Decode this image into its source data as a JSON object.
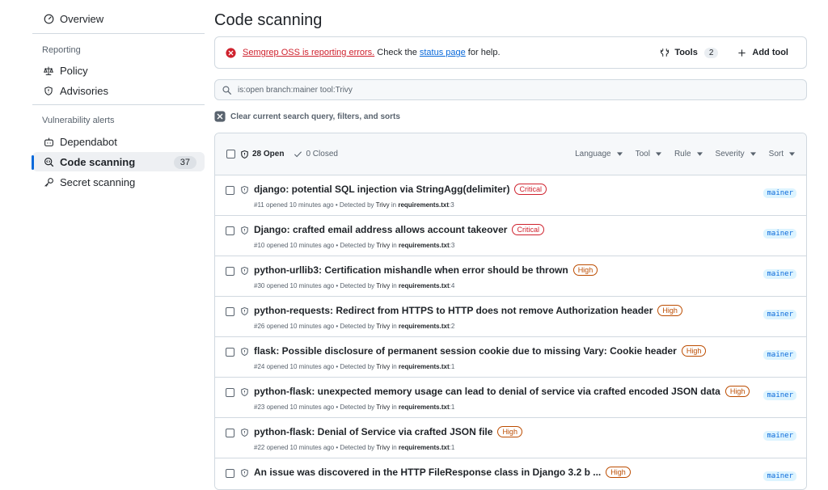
{
  "sidebar": {
    "overview": "Overview",
    "reporting_heading": "Reporting",
    "policy": "Policy",
    "advisories": "Advisories",
    "vuln_heading": "Vulnerability alerts",
    "dependabot": "Dependabot",
    "code_scanning": "Code scanning",
    "code_scanning_count": "37",
    "secret_scanning": "Secret scanning"
  },
  "page_title": "Code scanning",
  "alert": {
    "error_link": "Semgrep OSS is reporting errors.",
    "text_mid": " Check the ",
    "status_link": "status page",
    "text_end": " for help.",
    "tools_label": "Tools",
    "tools_count": "2",
    "add_tool": "Add tool"
  },
  "search": {
    "query": "is:open branch:mainer tool:Trivy"
  },
  "clear_label": "Clear current search query, filters, and sorts",
  "list_header": {
    "open": "28 Open",
    "closed": "0 Closed",
    "filters": [
      "Language",
      "Tool",
      "Rule",
      "Severity",
      "Sort"
    ]
  },
  "rows": [
    {
      "title": "django: potential SQL injection via StringAgg(delimiter)",
      "severity": "Critical",
      "num": "#11",
      "file": "requirements.txt",
      "line": ":3",
      "branch": "mainer"
    },
    {
      "title": "Django: crafted email address allows account takeover",
      "severity": "Critical",
      "num": "#10",
      "file": "requirements.txt",
      "line": ":3",
      "branch": "mainer"
    },
    {
      "title": "python-urllib3: Certification mishandle when error should be thrown",
      "severity": "High",
      "num": "#30",
      "file": "requirements.txt",
      "line": ":4",
      "branch": "mainer"
    },
    {
      "title": "python-requests: Redirect from HTTPS to HTTP does not remove Authorization header",
      "severity": "High",
      "num": "#26",
      "file": "requirements.txt",
      "line": ":2",
      "branch": "mainer"
    },
    {
      "title": "flask: Possible disclosure of permanent session cookie due to missing Vary: Cookie header",
      "severity": "High",
      "num": "#24",
      "file": "requirements.txt",
      "line": ":1",
      "branch": "mainer"
    },
    {
      "title": "python-flask: unexpected memory usage can lead to denial of service via crafted encoded JSON data",
      "severity": "High",
      "num": "#23",
      "file": "requirements.txt",
      "line": ":1",
      "branch": "mainer"
    },
    {
      "title": "python-flask: Denial of Service via crafted JSON file",
      "severity": "High",
      "num": "#22",
      "file": "requirements.txt",
      "line": ":1",
      "branch": "mainer"
    },
    {
      "title": "An issue was discovered in the HTTP FileResponse class in Django 3.2 b ...",
      "severity": "High",
      "num": "",
      "file": "",
      "line": "",
      "branch": "mainer"
    }
  ],
  "row_meta": {
    "opened": " opened 10 minutes ago • Detected by ",
    "tool": "Trivy",
    "in": " in "
  },
  "colors": {
    "accent": "#0969da",
    "critical": "#cf222e",
    "high": "#bc4c00"
  }
}
